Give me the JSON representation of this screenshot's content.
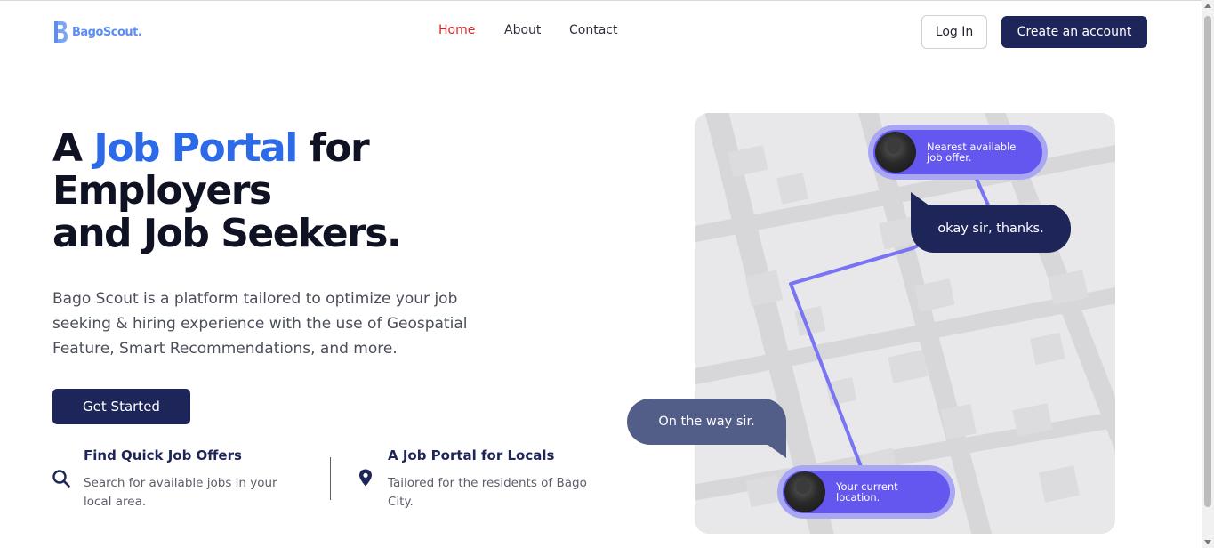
{
  "brand": {
    "name": "BagoScout.",
    "accent": "#5b8ef2"
  },
  "nav": {
    "items": [
      {
        "label": "Home",
        "active": true
      },
      {
        "label": "About",
        "active": false
      },
      {
        "label": "Contact",
        "active": false
      }
    ]
  },
  "header": {
    "login_label": "Log In",
    "create_account_label": "Create an account"
  },
  "hero": {
    "title_prefix": "A ",
    "title_accent": "Job Portal",
    "title_suffix_line1": " for",
    "title_line2": "Employers",
    "title_line3": "and Job Seekers.",
    "description": "Bago Scout is a platform tailored to optimize your job seeking & hiring experience with the use of Geospatial Feature, Smart Recommendations, and more.",
    "cta_label": "Get Started"
  },
  "features": [
    {
      "icon": "search-icon",
      "title": "Find Quick Job Offers",
      "text": "Search for available jobs in your local area."
    },
    {
      "icon": "map-pin-icon",
      "title": "A Job Portal for Locals",
      "text": "Tailored for the residents of Bago City."
    }
  ],
  "map": {
    "destination_label": "Nearest available job offer.",
    "origin_label": "Your current location.",
    "chat_reply": "okay sir, thanks.",
    "chat_message": "On the way sir.",
    "route_color": "#7a74f4",
    "pin_color": "#6457f0"
  },
  "colors": {
    "primary": "#1e2558",
    "accent_blue": "#2c6ae8",
    "nav_active": "#d62828"
  }
}
